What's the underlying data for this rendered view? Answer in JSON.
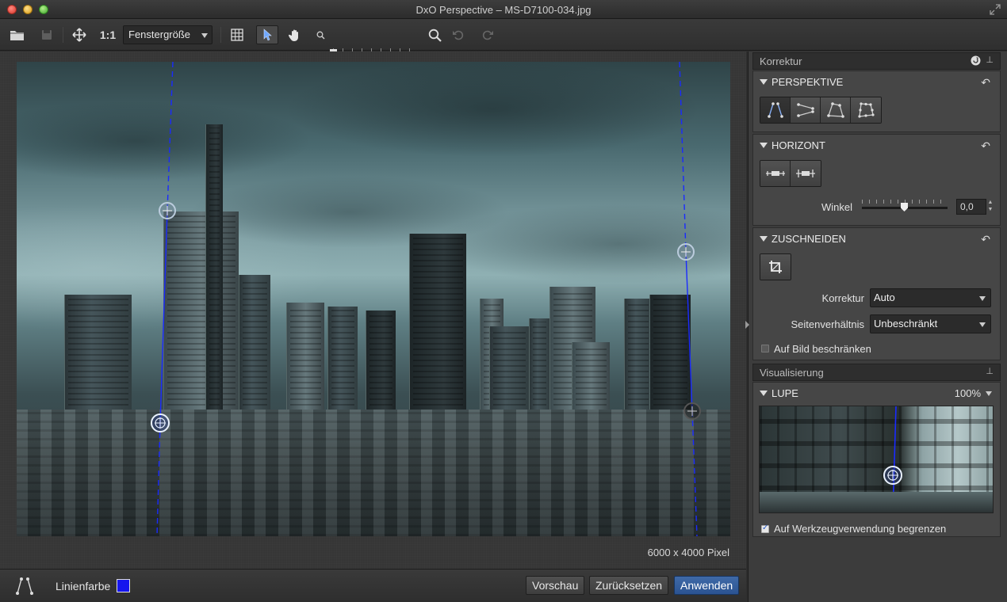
{
  "window": {
    "title": "DxO Perspective – MS-D7100-034.jpg"
  },
  "toolbar": {
    "zoom_ratio_label": "1:1",
    "fit_select_value": "Fenstergröße"
  },
  "image": {
    "dimensions_label": "6000 x 4000 Pixel"
  },
  "bottombar": {
    "line_color_label": "Linienfarbe",
    "line_color": "#1616ee",
    "preview_label": "Vorschau",
    "reset_label": "Zurücksetzen",
    "apply_label": "Anwenden"
  },
  "panel": {
    "correction_header": "Korrektur",
    "perspective": {
      "title": "PERSPEKTIVE"
    },
    "horizon": {
      "title": "HORIZONT",
      "angle_label": "Winkel",
      "angle_value": "0,0"
    },
    "crop": {
      "title": "ZUSCHNEIDEN",
      "correction_label": "Korrektur",
      "correction_value": "Auto",
      "aspect_label": "Seitenverhältnis",
      "aspect_value": "Unbeschränkt",
      "constrain_label": "Auf Bild beschränken",
      "constrain_checked": false
    },
    "visualization_header": "Visualisierung",
    "loupe": {
      "title": "LUPE",
      "zoom_value": "100%",
      "limit_label": "Auf Werkzeugverwendung begrenzen",
      "limit_checked": true
    }
  },
  "colors": {
    "accent_blue": "#2b5392",
    "guide_line": "#1a2aff"
  }
}
